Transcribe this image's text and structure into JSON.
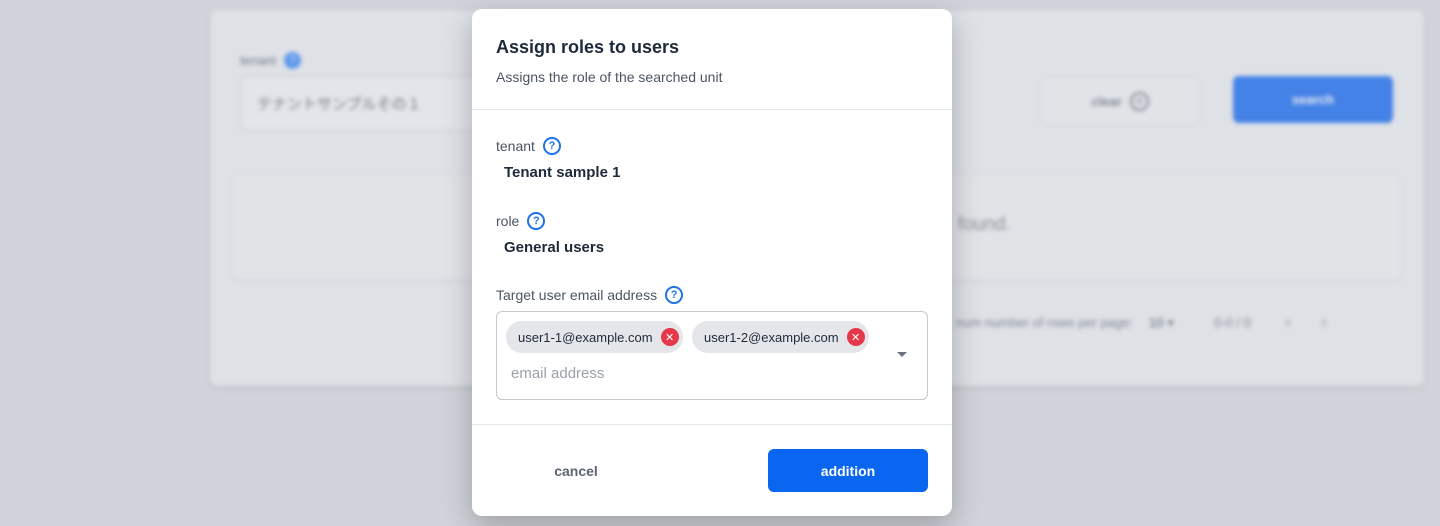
{
  "background": {
    "tenant_label": "tenant",
    "help_glyph": "?",
    "tenant_value": "テナントサンプルその１",
    "clear_label": "clear",
    "search_label": "search",
    "no_results_text": "found.",
    "rows_per_page_label": "num number of rows per page:",
    "rows_per_page_value": "10",
    "range_text": "0-0 / 0"
  },
  "modal": {
    "title": "Assign roles to users",
    "subtitle": "Assigns the role of the searched unit",
    "tenant": {
      "label": "tenant",
      "value": "Tenant sample 1",
      "icon": "question-circle-icon"
    },
    "role": {
      "label": "role",
      "value": "General users",
      "icon": "question-circle-icon"
    },
    "email": {
      "label": "Target user email address",
      "icon": "question-circle-icon",
      "placeholder": "email address",
      "chips": [
        "user1-1@example.com",
        "user1-2@example.com"
      ]
    },
    "cancel_label": "cancel",
    "add_label": "addition"
  },
  "colors": {
    "primary": "#0a66f0",
    "chip_remove": "#e5394b",
    "help_icon": "#1e73e8"
  }
}
